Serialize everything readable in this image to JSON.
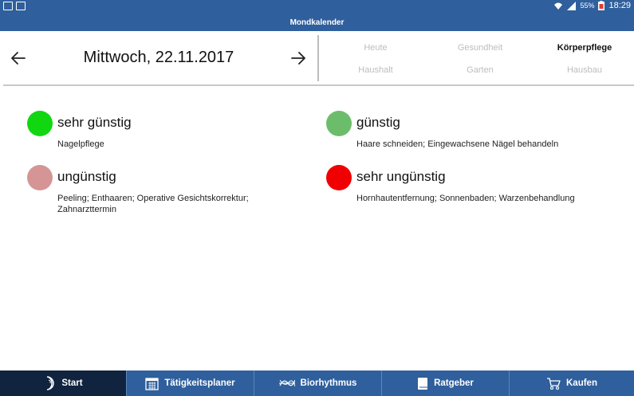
{
  "status": {
    "battery": "55%",
    "time": "18:29"
  },
  "app": {
    "title": "Mondkalender"
  },
  "date": {
    "label": "Mittwoch, 22.11.2017"
  },
  "categories": [
    {
      "label": "Heute"
    },
    {
      "label": "Gesundheit"
    },
    {
      "label": "Körperpflege",
      "active": true
    },
    {
      "label": "Haushalt"
    },
    {
      "label": "Garten"
    },
    {
      "label": "Hausbau"
    }
  ],
  "legend": [
    {
      "title": "sehr günstig",
      "desc": "Nagelpflege",
      "color": "#11d711"
    },
    {
      "title": "günstig",
      "desc": "Haare schneiden; Eingewachsene Nägel behandeln",
      "color": "#6cbd6b"
    },
    {
      "title": "ungünstig",
      "desc": "Peeling; Enthaaren; Operative Gesichtskorrektur; Zahnarzttermin",
      "color": "#d59595"
    },
    {
      "title": "sehr ungünstig",
      "desc": "Hornhautentfernung; Sonnenbaden; Warzenbehandlung",
      "color": "#f00000"
    }
  ],
  "tabs": [
    {
      "label": "Start",
      "icon": "moon-icon",
      "active": true
    },
    {
      "label": "Tätigkeitsplaner",
      "icon": "calendar-icon"
    },
    {
      "label": "Biorhythmus",
      "icon": "wave-icon"
    },
    {
      "label": "Ratgeber",
      "icon": "book-icon"
    },
    {
      "label": "Kaufen",
      "icon": "cart-icon"
    }
  ],
  "colors": {
    "primary": "#2f5f9c",
    "active_tab": "#10233f",
    "inactive_category": "#bdbdbd"
  }
}
